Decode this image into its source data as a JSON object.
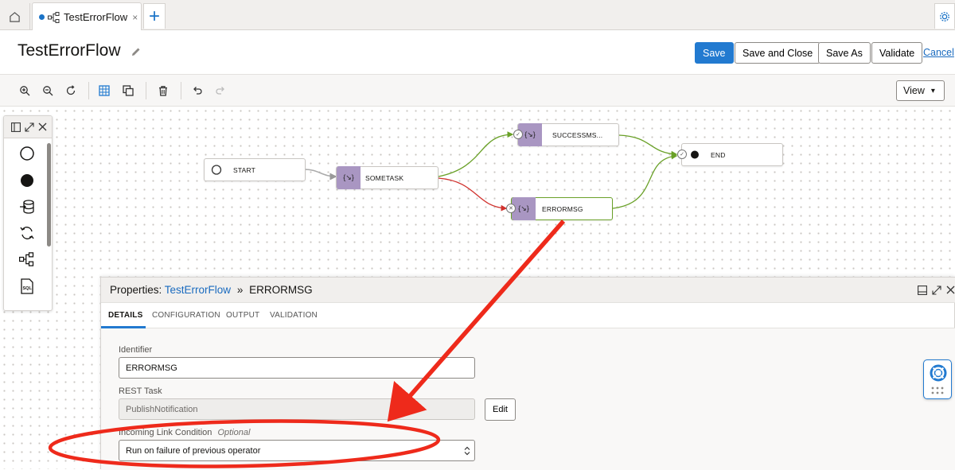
{
  "tabs": {
    "flow_tab_label": "TestErrorFlow",
    "close_glyph": "×",
    "add_glyph": "+"
  },
  "header": {
    "title": "TestErrorFlow",
    "save_label": "Save",
    "save_close_label": "Save and Close",
    "save_as_label": "Save As",
    "validate_label": "Validate",
    "cancel_label": "Cancel"
  },
  "toolbar": {
    "view_label": "View",
    "view_caret": "▾",
    "icons": [
      "zoom-in-icon",
      "zoom-out-icon",
      "reset-icon",
      "grid-icon",
      "copy-icon",
      "delete-icon",
      "undo-icon",
      "redo-icon"
    ]
  },
  "palette": {
    "items": [
      "start-operator-icon",
      "end-operator-icon",
      "data-loader-icon",
      "integration-task-icon",
      "pipeline-task-icon",
      "sql-task-icon"
    ]
  },
  "flow": {
    "nodes": {
      "start": "START",
      "sometask": "SOMETASK",
      "success": "SUCCESSMS...",
      "error": "ERRORMSG",
      "end": "END"
    },
    "task_glyph": "{↘}"
  },
  "properties": {
    "prefix": "Properties:",
    "flow_link": "TestErrorFlow",
    "separator": "»",
    "node_name": "ERRORMSG",
    "tabs": [
      "DETAILS",
      "CONFIGURATION",
      "OUTPUT",
      "VALIDATION"
    ],
    "identifier_label": "Identifier",
    "identifier_value": "ERRORMSG",
    "rest_task_label": "REST Task",
    "rest_task_value": "PublishNotification",
    "edit_label": "Edit",
    "condition_label": "Incoming Link Condition",
    "condition_optional": "Optional",
    "condition_value": "Run on failure of previous operator"
  },
  "colors": {
    "accent": "#227ad0",
    "success_link": "#6aa128",
    "failure_link": "#d0312d",
    "annotation": "#ee2a1b",
    "task_node": "#a996c2"
  }
}
